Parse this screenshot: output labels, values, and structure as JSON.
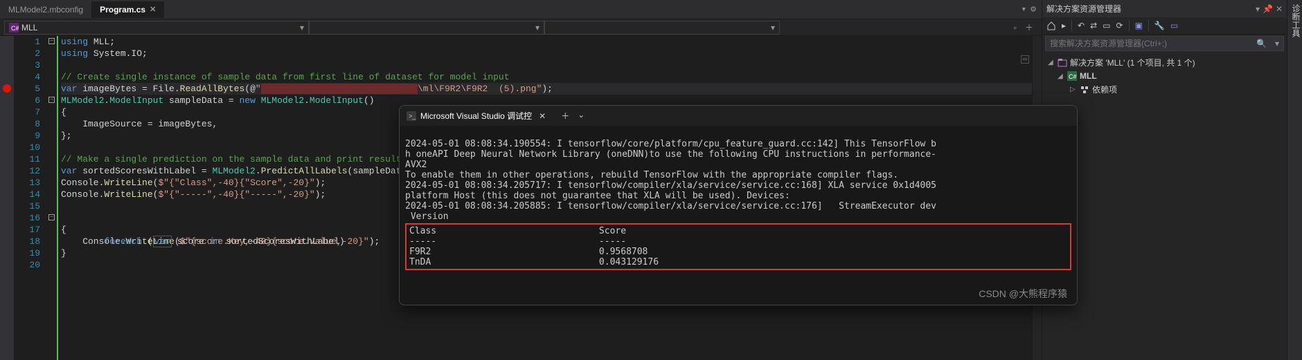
{
  "tabs": {
    "inactive": "MLModel2.mbconfig",
    "active": "Program.cs"
  },
  "context": {
    "project": "MLL"
  },
  "gutter": {
    "lines": [
      "1",
      "2",
      "3",
      "4",
      "5",
      "6",
      "7",
      "8",
      "9",
      "10",
      "11",
      "12",
      "13",
      "14",
      "15",
      "16",
      "17",
      "18",
      "19",
      "20"
    ]
  },
  "code": {
    "l1_a": "using",
    "l1_b": " MLL;",
    "l2_a": "using",
    "l2_b": " System.IO;",
    "l4": "// Create single instance of sample data from first line of dataset for model input",
    "l5_a": "var",
    "l5_b": " imageBytes = File.",
    "l5_c": "ReadAllBytes",
    "l5_d": "(@",
    "l5_e": "\"",
    "l5_f": "\\ml\\F9R2\\F9R2  (5).png\"",
    "l5_g": ");",
    "l6_a": "MLModel2",
    "l6_b": ".",
    "l6_c": "ModelInput",
    "l6_d": " sampleData = ",
    "l6_e": "new",
    "l6_f": " ",
    "l6_g": "MLModel2",
    "l6_h": ".",
    "l6_i": "ModelInput",
    "l6_j": "()",
    "l7": "{",
    "l8": "    ImageSource = imageBytes,",
    "l9": "};",
    "l11": "// Make a single prediction on the sample data and print results.",
    "l12_a": "var",
    "l12_b": " sortedScoresWithLabel = ",
    "l12_c": "MLModel2",
    "l12_d": ".",
    "l12_e": "PredictAllLabels",
    "l12_f": "(sampleData);",
    "l13_a": "Console.",
    "l13_b": "WriteLine",
    "l13_c": "(",
    "l13_d": "$\"{\"Class\",-40}{\"Score\",-20}\"",
    "l13_e": ");",
    "l14_a": "Console.",
    "l14_b": "WriteLine",
    "l14_c": "(",
    "l14_d": "$\"{\"-----\",-40}{\"-----\",-20}\"",
    "l14_e": ");",
    "l16_a": "foreach",
    "l16_b": " (",
    "l16_c": "var",
    "l16_d": " score ",
    "l16_e": "in",
    "l16_f": " sortedScoresWithLabel)",
    "l17": "{",
    "l18_a": "    Console.",
    "l18_b": "WriteLine",
    "l18_c": "(",
    "l18_d": "$\"{score.Key,-40}{score.Value,-20}\"",
    "l18_e": ");",
    "l19": "}"
  },
  "debug": {
    "title": "Microsoft Visual Studio 调试控",
    "line1": "2024-05-01 08:08:34.190554: I tensorflow/core/platform/cpu_feature_guard.cc:142] This TensorFlow b",
    "line2": "h oneAPI Deep Neural Network Library (oneDNN)to use the following CPU instructions in performance-",
    "line3": "AVX2",
    "line4": "To enable them in other operations, rebuild TensorFlow with the appropriate compiler flags.",
    "line5": "2024-05-01 08:08:34.205717: I tensorflow/compiler/xla/service/service.cc:168] XLA service 0x1d4005",
    "line6": "platform Host (this does not guarantee that XLA will be used). Devices:",
    "line7": "2024-05-01 08:08:34.205885: I tensorflow/compiler/xla/service/service.cc:176]   StreamExecutor dev",
    "line8": " Version",
    "hdr": "Class                              Score",
    "sep": "-----                              -----",
    "r1": "F9R2                               0.9568708",
    "r2": "TnDA                               0.043129176"
  },
  "solution": {
    "panel_title": "解决方案资源管理器",
    "search_placeholder": "搜索解决方案资源管理器(Ctrl+;)",
    "root": "解决方案 'MLL' (1 个项目, 共 1 个)",
    "project": "MLL",
    "deps": "依赖项"
  },
  "diag": {
    "label": "诊断工具"
  },
  "watermark": "CSDN @大熊程序猿"
}
